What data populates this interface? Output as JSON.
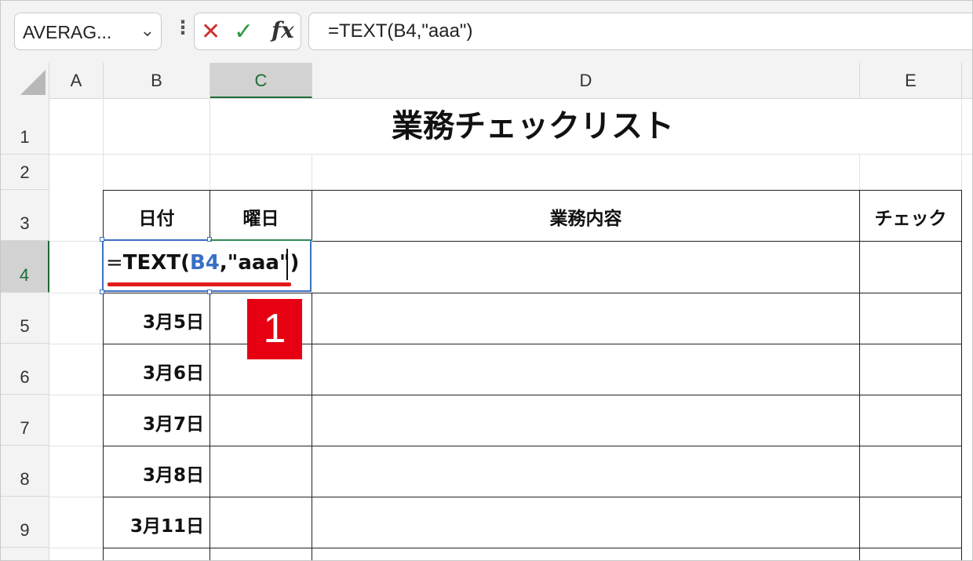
{
  "name_box": {
    "value": "AVERAG...",
    "dropdown_icon": "chevron-down-icon"
  },
  "formula_bar": {
    "more_icon": "vertical-dots-icon",
    "cancel_icon": "close-icon",
    "enter_icon": "check-icon",
    "fx_label": "fx",
    "value": "=TEXT(B4,\"aaa\")"
  },
  "columns": [
    {
      "label": "A",
      "selected": false
    },
    {
      "label": "B",
      "selected": false
    },
    {
      "label": "C",
      "selected": true
    },
    {
      "label": "D",
      "selected": false
    },
    {
      "label": "E",
      "selected": false
    }
  ],
  "rows": [
    "1",
    "2",
    "3",
    "4",
    "5",
    "6",
    "7",
    "8",
    "9"
  ],
  "selected_row": "4",
  "sheet": {
    "title": "業務チェックリスト",
    "headers": {
      "date": "日付",
      "weekday": "曜日",
      "task": "業務内容",
      "check": "チェック"
    },
    "dates": [
      "3月5日",
      "3月6日",
      "3月7日",
      "3月8日",
      "3月11日"
    ]
  },
  "editing_cell": {
    "eq": "=",
    "func": "TEXT(",
    "ref": "B4",
    "rest": ",\"aaa\")"
  },
  "step_badge": "1",
  "colors": {
    "selection_border": "#3c6fc7",
    "header_selected": "#1e6a36",
    "annotation_red": "#e60012",
    "reference_blue": "#3a6fc4"
  }
}
